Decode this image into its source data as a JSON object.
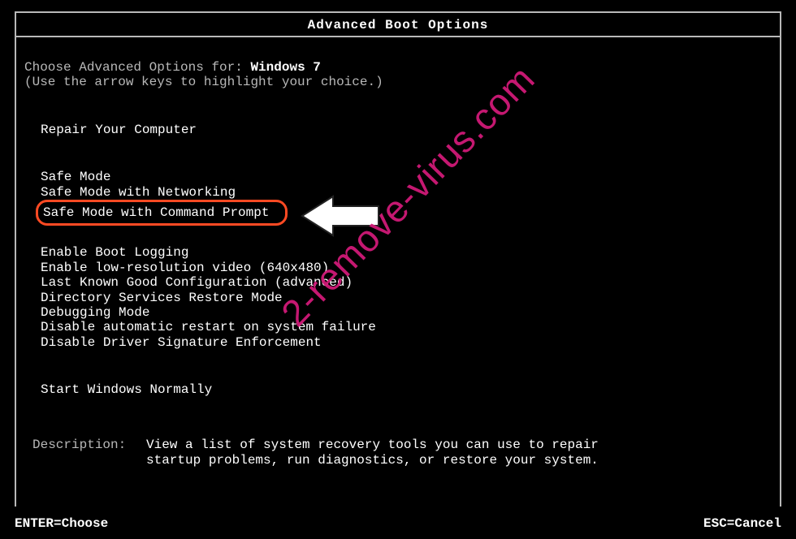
{
  "title": "Advanced Boot Options",
  "choose_prefix": "Choose Advanced Options for: ",
  "os_name": "Windows 7",
  "hint": "(Use the arrow keys to highlight your choice.)",
  "menu": {
    "repair": "Repair Your Computer",
    "safe_mode": "Safe Mode",
    "safe_mode_net": "Safe Mode with Networking",
    "safe_mode_cmd": "Safe Mode with Command Prompt",
    "boot_log": "Enable Boot Logging",
    "low_res": "Enable low-resolution video (640x480)",
    "lkgc": "Last Known Good Configuration (advanced)",
    "dsrm": "Directory Services Restore Mode",
    "debug": "Debugging Mode",
    "no_restart": "Disable automatic restart on system failure",
    "no_sig": "Disable Driver Signature Enforcement",
    "normal": "Start Windows Normally"
  },
  "description": {
    "label": "Description:",
    "line1": "View a list of system recovery tools you can use to repair",
    "line2": "startup problems, run diagnostics, or restore your system."
  },
  "footer": {
    "enter": "ENTER=Choose",
    "esc": "ESC=Cancel"
  },
  "watermark": "2-remove-virus.com"
}
